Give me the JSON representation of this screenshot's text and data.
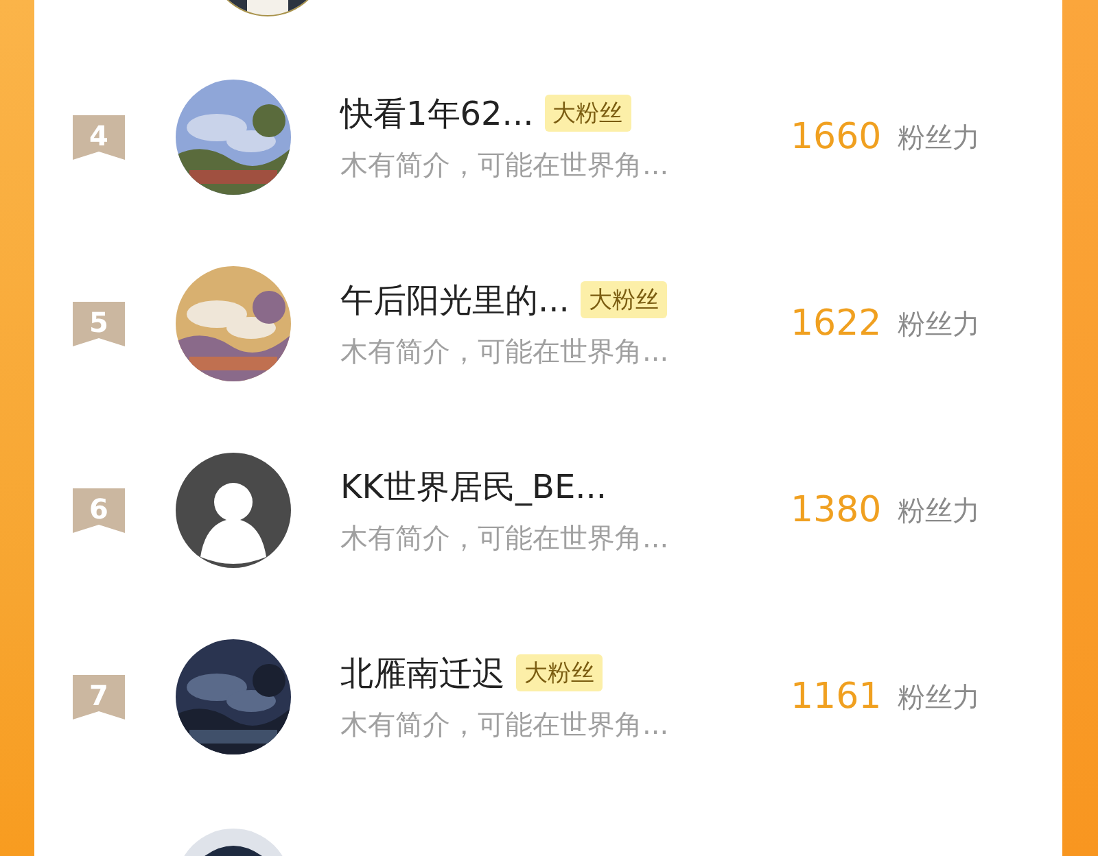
{
  "fans": [
    {
      "rank": "4",
      "name": "快看1年62...",
      "badge": "大粉丝",
      "intro": "木有简介，可能在世界角...",
      "score": "1660",
      "score_unit": "粉丝力"
    },
    {
      "rank": "5",
      "name": "午后阳光里的...",
      "badge": "大粉丝",
      "intro": "木有简介，可能在世界角...",
      "score": "1622",
      "score_unit": "粉丝力"
    },
    {
      "rank": "6",
      "avatar": {
        "kind": "default"
      },
      "name": "KK世界居民_BE...",
      "intro": "木有简介，可能在世界角...",
      "score": "1380",
      "score_unit": "粉丝力"
    },
    {
      "rank": "7",
      "name": "北雁南迁迟",
      "badge": "大粉丝",
      "intro": "木有简介，可能在世界角...",
      "score": "1161",
      "score_unit": "粉丝力"
    }
  ]
}
